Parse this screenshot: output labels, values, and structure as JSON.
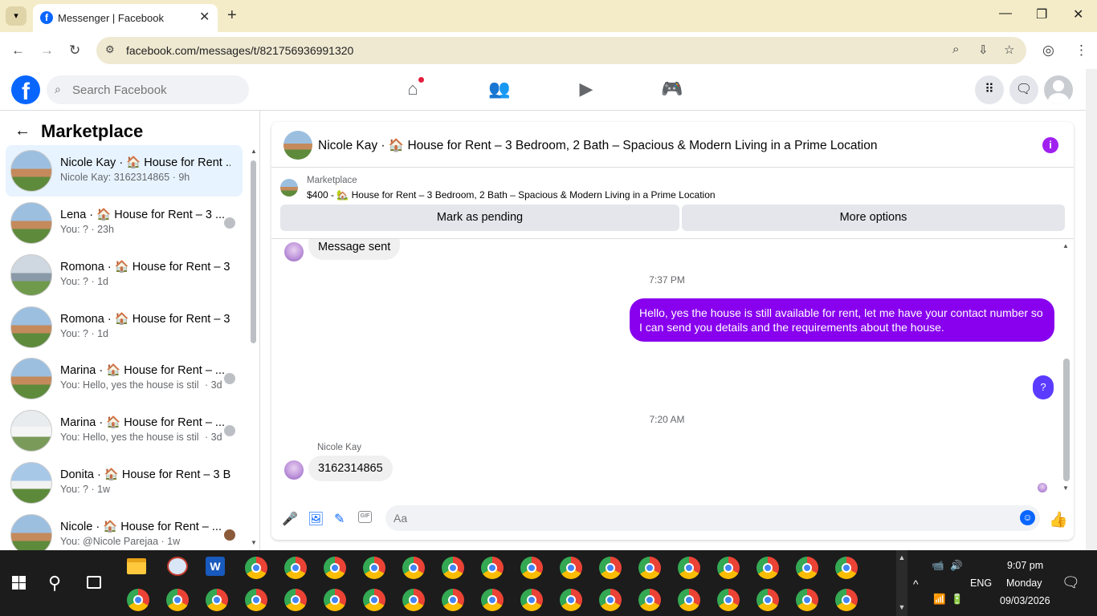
{
  "browser": {
    "tab_title": "Messenger | Facebook",
    "url": "facebook.com/messages/t/821756936991320"
  },
  "fb": {
    "search_placeholder": "Search Facebook"
  },
  "sidebar": {
    "title": "Marketplace",
    "conversations": [
      {
        "name": "Nicole Kay · 🏠 House for Rent ...",
        "preview": "Nicole Kay: 3162314865 · 9h",
        "meta": ""
      },
      {
        "name": "Lena · 🏠 House for Rent – 3 ...",
        "preview": "You: ? · 23h",
        "meta": ""
      },
      {
        "name": "Romona · 🏠 House for Rent – 3...",
        "preview": "You: ? · 1d",
        "meta": ""
      },
      {
        "name": "Romona · 🏠 House for Rent – 3...",
        "preview": "You: ? · 1d",
        "meta": ""
      },
      {
        "name": "Marina · 🏠 House for Rent – ...",
        "preview": "You: Hello, yes the house is still ...",
        "meta": "· 3d"
      },
      {
        "name": "Marina · 🏠 House for Rent – ...",
        "preview": "You: Hello, yes the house is still ...",
        "meta": "· 3d"
      },
      {
        "name": "Donita · 🏠 House for Rent – 3 B...",
        "preview": "You: ? · 1w",
        "meta": ""
      },
      {
        "name": "Nicole · 🏠 House for Rent – ...",
        "preview": "You: @Nicole Parejaa · 1w",
        "meta": ""
      }
    ]
  },
  "chat": {
    "header_title": "Nicole Kay · 🏠 House for Rent – 3 Bedroom, 2 Bath – Spacious & Modern Living in a Prime Location",
    "marketplace_label": "Marketplace",
    "listing": "$400 - 🏡 House for Rent – 3 Bedroom, 2 Bath – Spacious & Modern Living in a Prime Location",
    "btn_pending": "Mark as pending",
    "btn_more": "More options",
    "messages": {
      "sent_notice": "Message sent",
      "time1": "7:37 PM",
      "outgoing": "Hello, yes the house is still available for rent, let me have your contact number so I can send you details and the requirements about the house.",
      "question": "?",
      "time2": "7:20 AM",
      "sender": "Nicole Kay",
      "incoming": "3162314865"
    },
    "input_placeholder": "Aa"
  },
  "taskbar": {
    "time": "9:07 pm",
    "day": "Monday",
    "date": "09/03/2026",
    "lang": "ENG"
  }
}
